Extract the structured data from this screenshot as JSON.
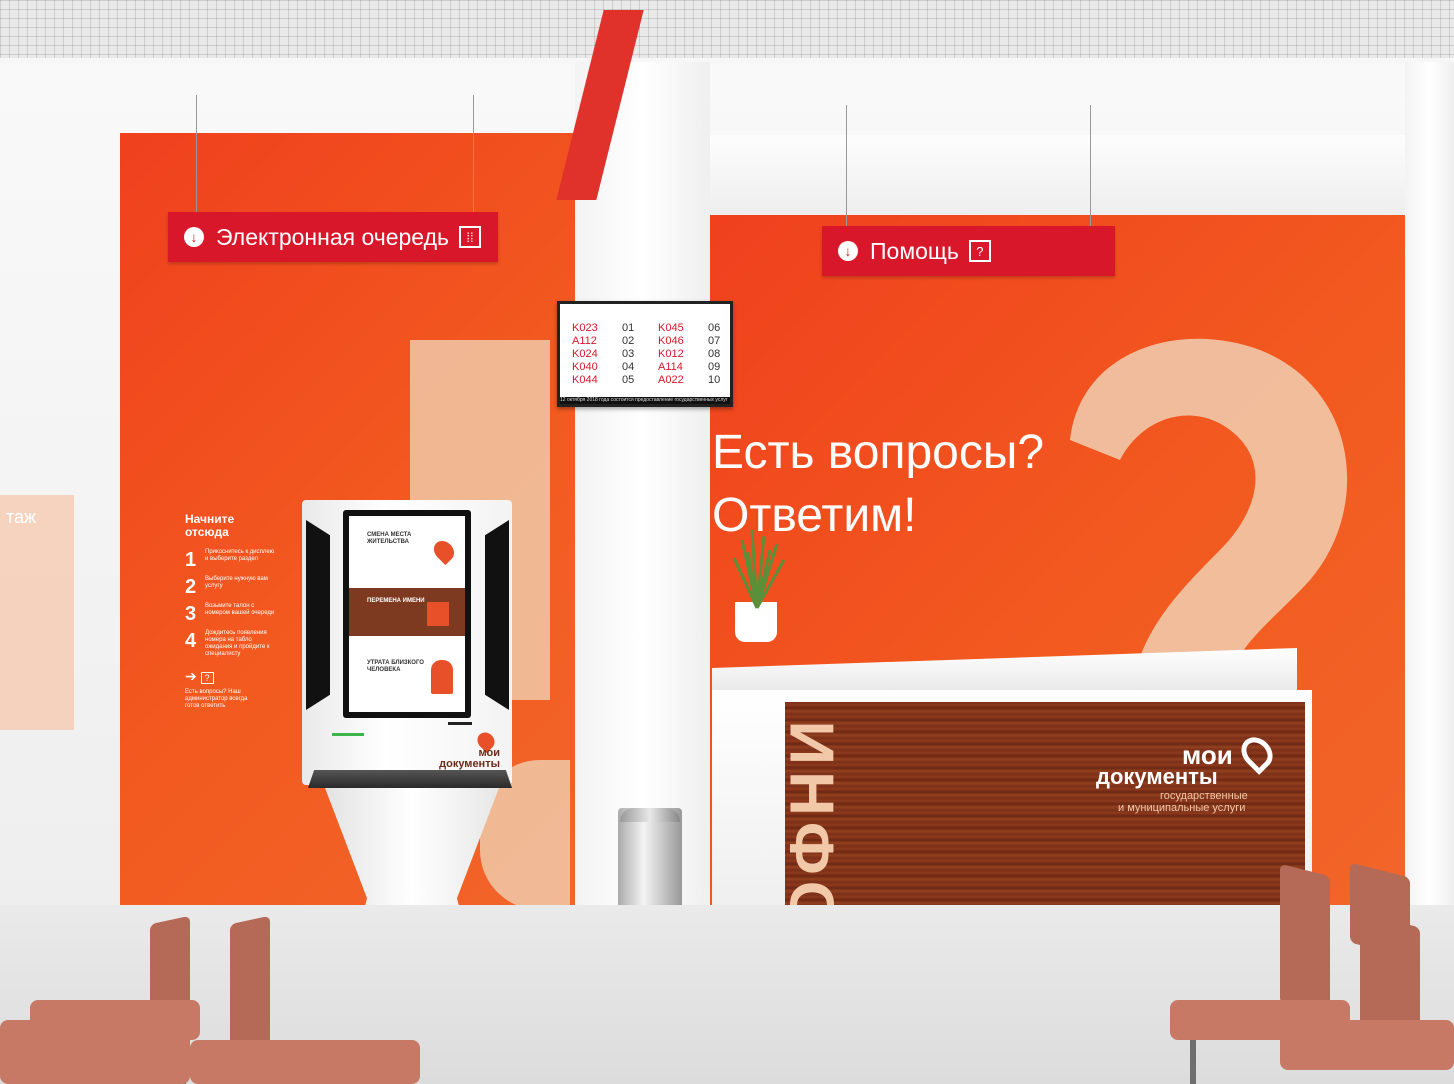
{
  "signs": {
    "queue": {
      "label": "Электронная очередь",
      "icon": "arrow-down-circle-icon",
      "people_icon": "people-icon"
    },
    "help": {
      "label": "Помощь",
      "icon": "arrow-down-circle-icon",
      "help_icon": "?"
    }
  },
  "queue_board": {
    "rows_left": [
      {
        "ticket": "K023",
        "window": "01"
      },
      {
        "ticket": "A112",
        "window": "02"
      },
      {
        "ticket": "K024",
        "window": "03"
      },
      {
        "ticket": "K040",
        "window": "04"
      },
      {
        "ticket": "K044",
        "window": "05"
      }
    ],
    "rows_right": [
      {
        "ticket": "K045",
        "window": "06"
      },
      {
        "ticket": "K046",
        "window": "07"
      },
      {
        "ticket": "K012",
        "window": "08"
      },
      {
        "ticket": "A114",
        "window": "09"
      },
      {
        "ticket": "A022",
        "window": "10"
      }
    ],
    "ticker": "12 октября 2018 года состоится предоставление государственных услуг"
  },
  "wall_text": {
    "line1": "Есть вопросы?",
    "line2": "Ответим!"
  },
  "steps_panel": {
    "heading": "Начните отсюда",
    "steps": [
      {
        "num": "1",
        "text": "Прикоснитесь к дисплею и выберите раздел"
      },
      {
        "num": "2",
        "text": "Выберите нужную вам услугу"
      },
      {
        "num": "3",
        "text": "Возьмите талон с номером вашей очереди"
      },
      {
        "num": "4",
        "text": "Дождитесь появления номера на табло ожидания и пройдите к специалисту"
      }
    ],
    "help_text": "Есть вопросы? Наш администратор всегда готов ответить",
    "left_panel_fragment": "таж"
  },
  "kiosk": {
    "tiles": [
      "СМЕНА МЕСТА ЖИТЕЛЬСТВА",
      "ПЕРЕМЕНА ИМЕНИ",
      "УТРАТА БЛИЗКОГО ЧЕЛОВЕКА"
    ],
    "brand": "мои документы"
  },
  "desk": {
    "side_text": "ИНФО",
    "brand_line1": "мои",
    "brand_line2": "документы",
    "brand_sub1": "государственные",
    "brand_sub2": "и муниципальные услуги"
  },
  "colors": {
    "brand_red": "#d9172a",
    "wall_orange": "#f04a1f",
    "beige": "#f1c8a8",
    "wood": "#7a2f17"
  }
}
